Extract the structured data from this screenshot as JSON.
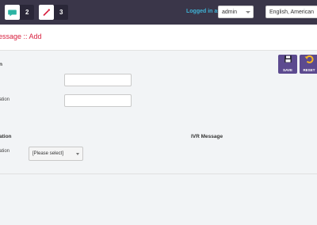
{
  "header": {
    "notifications": [
      {
        "icon": "chat-icon",
        "count": "2"
      },
      {
        "icon": "magic-wand-icon",
        "count": "3"
      }
    ],
    "logged_in_label": "Logged in as :",
    "user_select": "admin",
    "language_select": "English, American"
  },
  "page": {
    "title": "essage :: Add"
  },
  "actions": {
    "save_label": "SAVE",
    "reset_label": "RESET"
  },
  "form": {
    "section_heading": "n",
    "field1_label": "",
    "field2_label": "ation",
    "section2_heading": "ation",
    "ivr_heading": "IVR Message",
    "select_label": "ation",
    "select_value": "[Please select]"
  },
  "colors": {
    "topbar": "#3a3649",
    "title": "#d8203f",
    "logged_label": "#3fb3d6",
    "action_button": "#5c4a8f",
    "reset_icon": "#f5b820"
  }
}
